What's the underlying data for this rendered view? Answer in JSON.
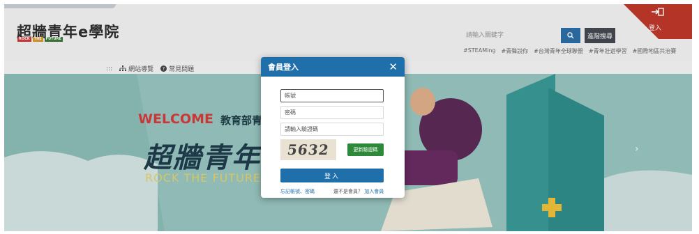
{
  "header": {
    "logo_title": "超牆青年e學院",
    "logo_sub": [
      "ROCK",
      "THE",
      "FUTURE"
    ],
    "search_placeholder": "請輸入關鍵字",
    "advanced_search_label": "進階搜尋",
    "hashtags": [
      "#STEAMing",
      "#青聲說你",
      "#台灣青年全球聯盟",
      "#青年壯遊學習",
      "#國際地區共治賽"
    ],
    "login_label": "登入"
  },
  "subnav": {
    "sitemap_label": "網站導覽",
    "faq_label": "常見問題"
  },
  "banner": {
    "welcome": "WELCOME",
    "welcome_sub": "教育部青",
    "big_title": "超牆青年",
    "rock_text": "ROCK THE FUTURE"
  },
  "modal": {
    "title": "會員登入",
    "close_glyph": "✕",
    "account_placeholder": "帳號",
    "password_placeholder": "密碼",
    "captcha_placeholder": "請輸入驗證碼",
    "captcha_value": "5632",
    "refresh_label": "更新驗證碼",
    "submit_label": "登入",
    "forgot_label": "忘記帳號、密碼",
    "not_member_label": "還不是會員？",
    "register_label": "加入會員"
  },
  "colors": {
    "primary": "#1f6fab",
    "green": "#2e8a3a",
    "corner_red": "#c0392b",
    "banner_teal": "#9ac6c1"
  }
}
